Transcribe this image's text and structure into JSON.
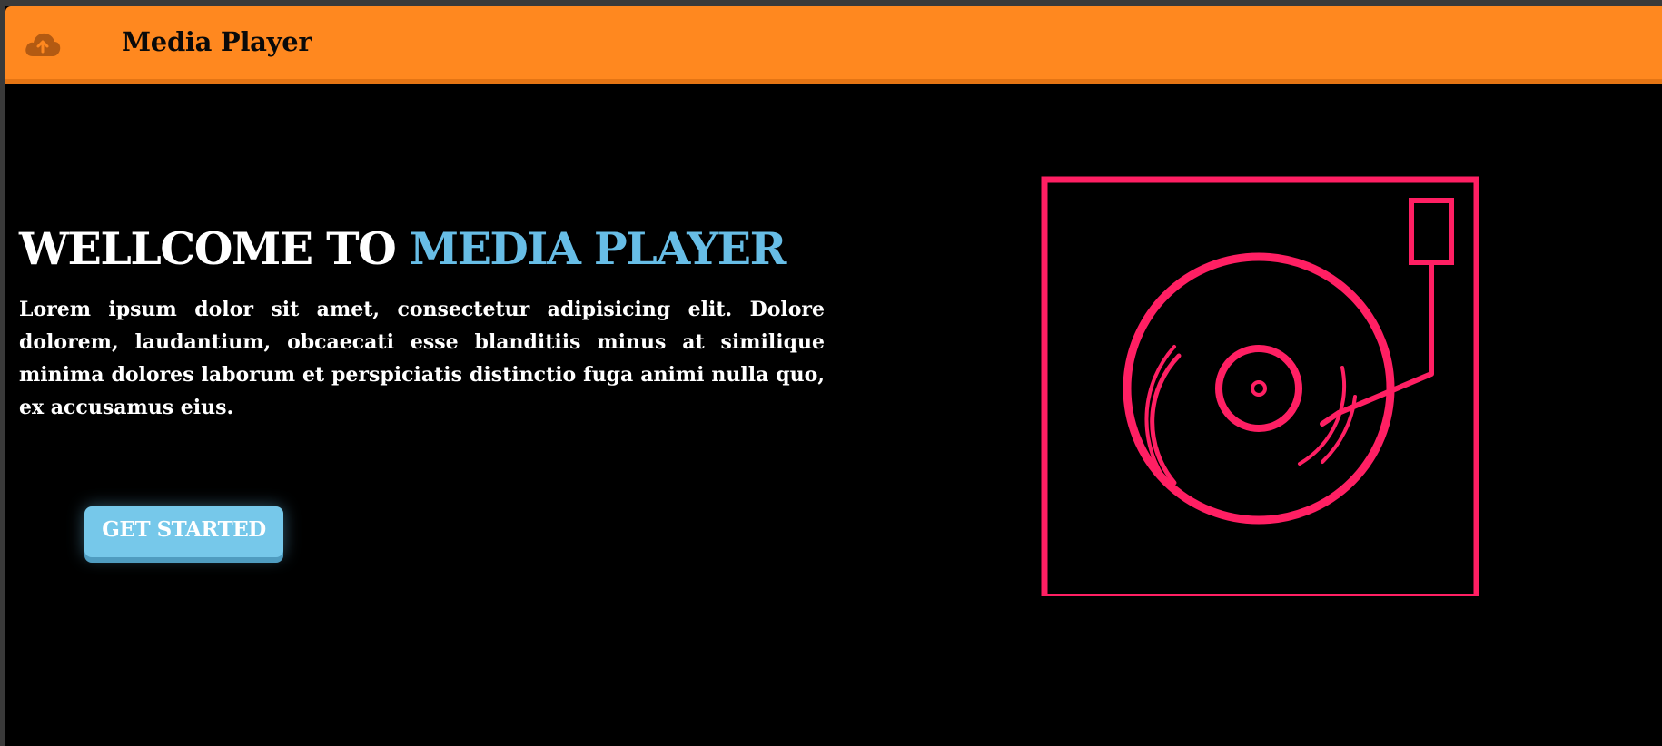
{
  "navbar": {
    "logo_icon": "cloud-upload-icon",
    "title": "Media Player",
    "background_color": "#ff881f"
  },
  "hero": {
    "heading_prefix": "WELLCOME TO ",
    "heading_accent": "MEDIA PLAYER",
    "accent_color": "#67bde6",
    "paragraph": "Lorem ipsum dolor sit amet, consectetur adipisicing elit. Dolore dolorem, laudantium, obcaecati esse blanditiis minus at similique minima dolores laborum et perspiciatis distinctio fuga animi nulla quo, ex accusamus eius.",
    "cta_label": "GET STARTED",
    "cta_color": "#76c8ea"
  },
  "illustration": {
    "icon": "turntable-icon",
    "stroke_color": "#ff1f63"
  }
}
